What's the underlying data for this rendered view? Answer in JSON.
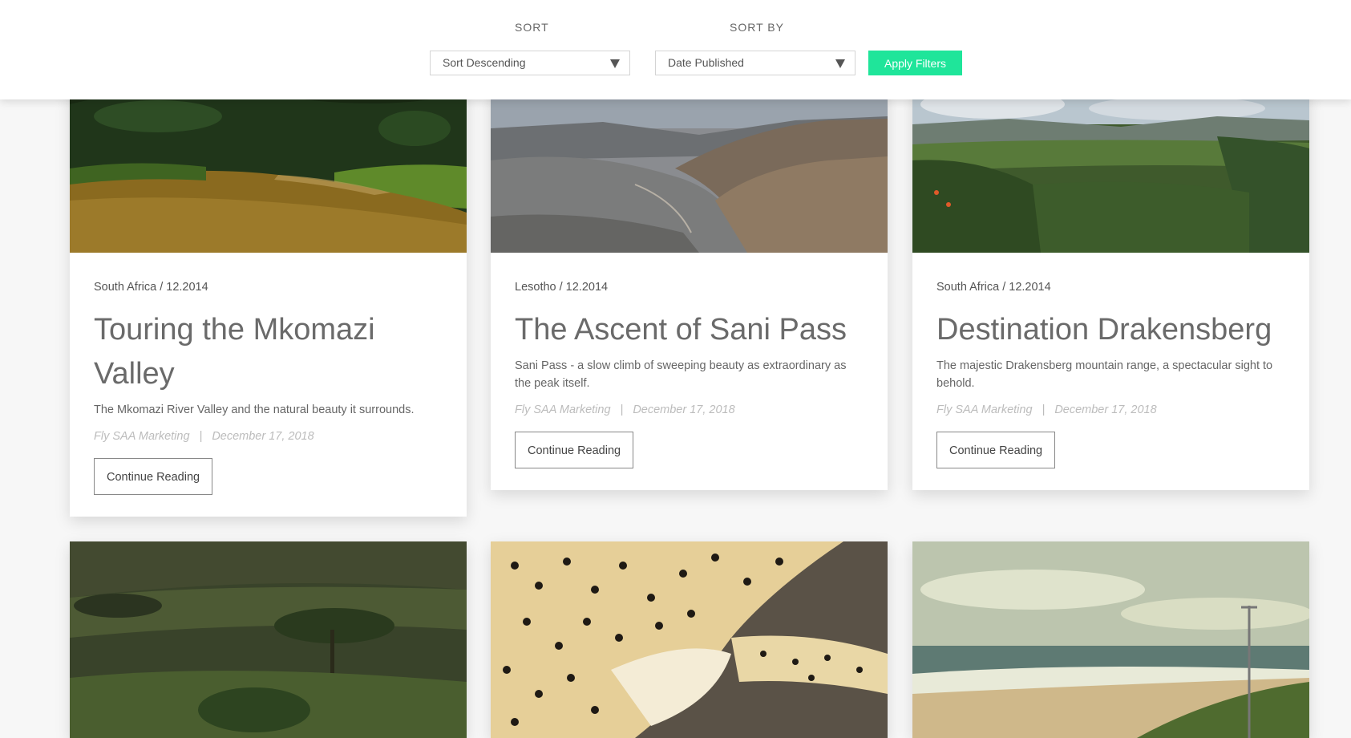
{
  "filters": {
    "sort_label": "SORT",
    "sort_value": "Sort Descending",
    "sort_by_label": "SORT BY",
    "sort_by_value": "Date Published",
    "apply_label": "Apply Filters"
  },
  "articles": [
    {
      "location": "South Africa / 12.2014",
      "title": "Touring the Mkomazi Valley",
      "excerpt": "The Mkomazi River Valley and the natural beauty it surrounds.",
      "author": "Fly SAA Marketing",
      "separator": "|",
      "date": "December 17, 2018",
      "cta": "Continue Reading"
    },
    {
      "location": "Lesotho / 12.2014",
      "title": "The Ascent of Sani Pass",
      "excerpt": "Sani Pass - a slow climb of sweeping beauty as extraordinary as the peak itself.",
      "author": "Fly SAA Marketing",
      "separator": "|",
      "date": "December 17, 2018",
      "cta": "Continue Reading"
    },
    {
      "location": "South Africa / 12.2014",
      "title": "Destination Drakensberg",
      "excerpt": "The majestic Drakensberg mountain range, a spectacular sight to behold.",
      "author": "Fly SAA Marketing",
      "separator": "|",
      "date": "December 17, 2018",
      "cta": "Continue Reading"
    }
  ],
  "colors": {
    "accent": "#1fe59a"
  }
}
